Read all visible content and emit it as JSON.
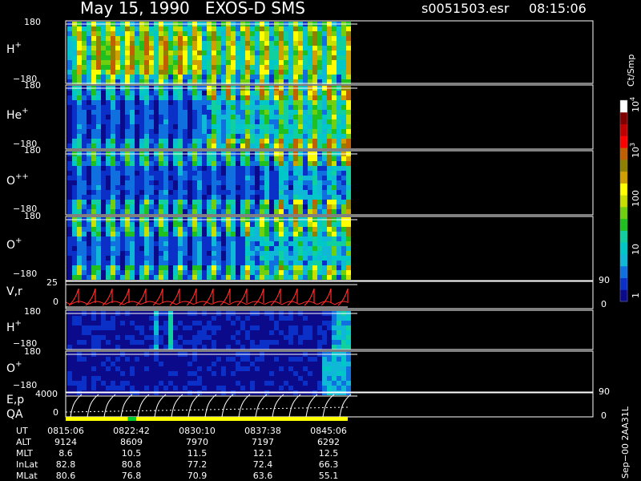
{
  "header": {
    "title": "May 15, 1990   EXOS-D SMS",
    "file": "s0051503.esr",
    "clock": "08:15:06"
  },
  "ion_panels": [
    {
      "label": "H",
      "sup": "+",
      "top": "180",
      "bottom": "−180",
      "style": "hplus_main"
    },
    {
      "label": "He",
      "sup": "+",
      "top": "180",
      "bottom": "−180",
      "style": "heplus"
    },
    {
      "label": "O",
      "sup": "++",
      "top": "180",
      "bottom": "−180",
      "style": "oplusplus"
    },
    {
      "label": "O",
      "sup": "+",
      "top": "180",
      "bottom": "−180",
      "style": "oplus"
    }
  ],
  "vr_panel": {
    "label": "V,r",
    "left_top": "25",
    "left_zero": "0",
    "right_top": "90",
    "right_zero": "0",
    "trace_color": "#ff2a2a"
  },
  "lower_panels": [
    {
      "label": "H",
      "sup": "+",
      "top": "180",
      "bottom": "−180",
      "style": "hplus_low"
    },
    {
      "label": "O",
      "sup": "+",
      "top": "180",
      "bottom": "−180",
      "style": "oplus_low"
    }
  ],
  "ep_panel": {
    "label": "E,p",
    "left_top": "4000",
    "left_zero": "0",
    "right_top": "90",
    "right_zero": "0",
    "trace_color": "#ffffff"
  },
  "qa_label": "QA",
  "qa_bar": {
    "base_color": "#ffff00",
    "flag_color": "#00cc33",
    "flag_start": 0.22,
    "flag_end": 0.25
  },
  "colorbar": {
    "unit": "Ct/Smp",
    "tick_labels": [
      "1",
      "10",
      "100",
      "10",
      "10"
    ],
    "tick_exps": [
      "",
      "",
      "",
      "3",
      "4"
    ],
    "colors": [
      "#0a0a8a",
      "#0a30c8",
      "#1070e0",
      "#10b8d8",
      "#00c8c8",
      "#10d0a0",
      "#20c020",
      "#70d010",
      "#c8e000",
      "#ffff00",
      "#d0a000",
      "#908000",
      "#c06000",
      "#ff0000",
      "#c00000",
      "#800000",
      "#ffffff"
    ]
  },
  "side_label": "Sep−00  2AA31L",
  "table": {
    "labels": [
      "UT",
      "ALT",
      "MLT",
      "InLat",
      "MLat"
    ],
    "columns": [
      [
        "0815:06",
        "9124",
        "8.6",
        "82.8",
        "80.6"
      ],
      [
        "0822:42",
        "8609",
        "10.5",
        "80.8",
        "76.8"
      ],
      [
        "0830:10",
        "7970",
        "11.5",
        "77.2",
        "70.9"
      ],
      [
        "0837:38",
        "7197",
        "12.1",
        "72.4",
        "63.6"
      ],
      [
        "0845:06",
        "6292",
        "12.5",
        "66.3",
        "55.1"
      ]
    ]
  },
  "chart_data": {
    "type": "heatmap",
    "title": "May 15, 1990   EXOS-D SMS",
    "x": [
      "0815:06",
      "0822:42",
      "0830:10",
      "0837:38",
      "0845:06"
    ],
    "data_end_fraction": 0.43,
    "panels": [
      {
        "name": "H+",
        "ylim": [
          -180,
          180
        ],
        "peak_level": 11
      },
      {
        "name": "He+",
        "ylim": [
          -180,
          180
        ],
        "peak_level": 12
      },
      {
        "name": "O++",
        "ylim": [
          -180,
          180
        ],
        "peak_level": 10
      },
      {
        "name": "O+",
        "ylim": [
          -180,
          180
        ],
        "peak_level": 10
      },
      {
        "name": "V,r",
        "ylim": [
          0,
          25
        ],
        "right_ylim": [
          0,
          90
        ]
      },
      {
        "name": "H+",
        "ylim": [
          -180,
          180
        ],
        "peak_level": 5
      },
      {
        "name": "O+",
        "ylim": [
          -180,
          180
        ],
        "peak_level": 3
      },
      {
        "name": "E,p",
        "ylim": [
          0,
          4000
        ],
        "right_ylim": [
          0,
          90
        ]
      }
    ],
    "colorbar_label": "Ct/Smp",
    "colorbar_range": [
      "1",
      "10^4"
    ]
  }
}
